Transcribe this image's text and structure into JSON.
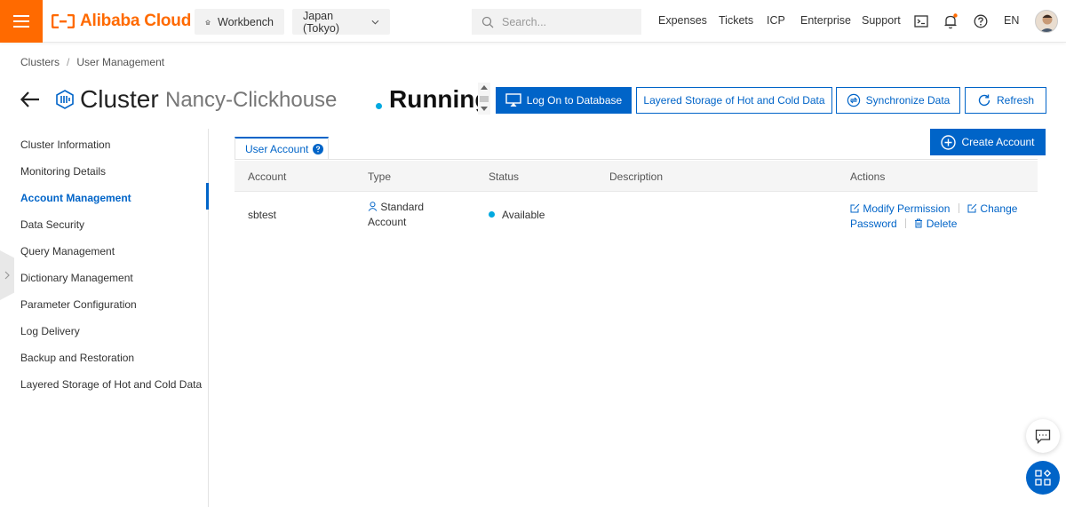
{
  "topbar": {
    "brand": "Alibaba Cloud",
    "workbench": "Workbench",
    "region": "Japan (Tokyo)",
    "search_placeholder": "Search...",
    "links": [
      "Expenses",
      "Tickets",
      "ICP",
      "Enterprise",
      "Support"
    ],
    "lang": "EN",
    "accent": "#ff6a00"
  },
  "breadcrumb": {
    "root": "Clusters",
    "separator": "/",
    "current": "User Management"
  },
  "header": {
    "title": "Cluster",
    "cluster_name": "Nancy-Clickhouse",
    "status": "Running",
    "buttons": {
      "logon": "Log On to Database",
      "layered": "Layered Storage of Hot and Cold Data",
      "sync": "Synchronize Data",
      "refresh": "Refresh"
    }
  },
  "nav": {
    "items": [
      "Cluster Information",
      "Monitoring Details",
      "Account Management",
      "Data Security",
      "Query Management",
      "Dictionary Management",
      "Parameter Configuration",
      "Log Delivery",
      "Backup and Restoration",
      "Layered Storage of Hot and Cold Data"
    ],
    "active": "Account Management"
  },
  "content": {
    "tab": "User Account",
    "create_button": "Create Account",
    "columns": [
      "Account",
      "Type",
      "Status",
      "Description",
      "Actions"
    ],
    "rows": [
      {
        "account": "sbtest",
        "type_line1": "Standard",
        "type_line2": "Account",
        "status": "Available",
        "description": "",
        "actions": {
          "modify": "Modify Permission",
          "change": "Change",
          "password": "Password",
          "delete": "Delete"
        }
      }
    ]
  },
  "colors": {
    "primary": "#0064c8",
    "status_dot": "#00a9e0"
  }
}
